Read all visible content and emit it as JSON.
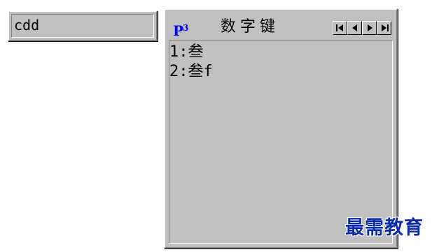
{
  "composition": {
    "text": "cdd"
  },
  "candidate_window": {
    "logo": "P",
    "logo_sup": "3",
    "title": "数字键",
    "nav_buttons": [
      "first-page-icon",
      "prev-page-icon",
      "next-page-icon",
      "last-page-icon"
    ],
    "items": [
      {
        "index": "1:",
        "text": "叁"
      },
      {
        "index": "2:",
        "text": "叁f"
      }
    ]
  },
  "watermark": {
    "text": "最需教育"
  },
  "colors": {
    "window_bg": "#c0c0c0",
    "logo": "#0000ff",
    "watermark": "#0a2aa8"
  }
}
